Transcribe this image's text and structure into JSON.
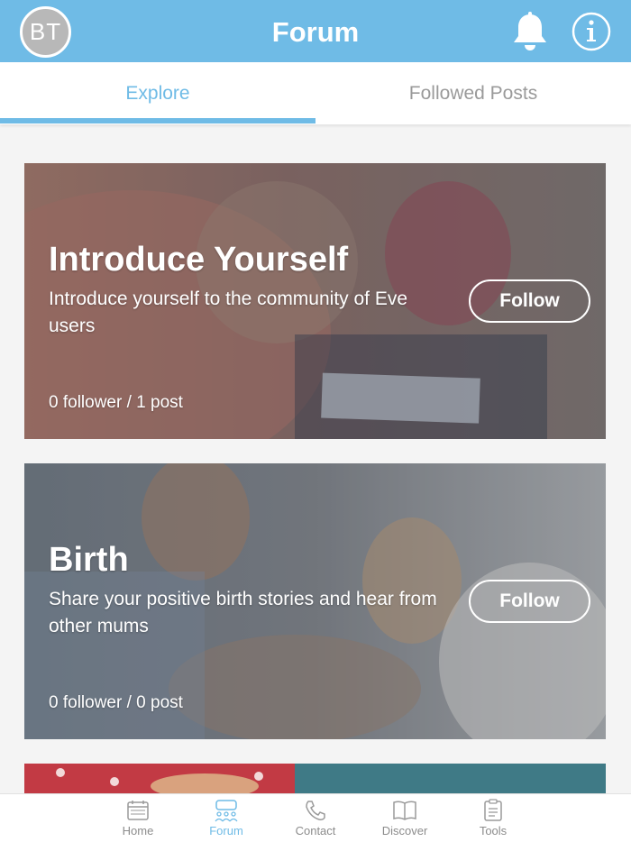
{
  "header": {
    "avatar_initials": "BT",
    "title": "Forum",
    "notification_icon": "bell-icon",
    "info_icon": "info-icon",
    "accent_color": "#6fbbe6"
  },
  "tabs": [
    {
      "label": "Explore",
      "active": true
    },
    {
      "label": "Followed Posts",
      "active": false
    }
  ],
  "forums": [
    {
      "title": "Introduce Yourself",
      "description": "Introduce yourself to the community of Eve users",
      "stats": "0 follower / 1 post",
      "follow_label": "Follow"
    },
    {
      "title": "Birth",
      "description": "Share your positive birth stories and hear from other mums",
      "stats": "0 follower / 0 post",
      "follow_label": "Follow"
    }
  ],
  "bottom_nav": [
    {
      "label": "Home",
      "icon": "calendar-icon",
      "active": false
    },
    {
      "label": "Forum",
      "icon": "forum-icon",
      "active": true
    },
    {
      "label": "Contact",
      "icon": "phone-icon",
      "active": false
    },
    {
      "label": "Discover",
      "icon": "book-icon",
      "active": false
    },
    {
      "label": "Tools",
      "icon": "clipboard-icon",
      "active": false
    }
  ]
}
